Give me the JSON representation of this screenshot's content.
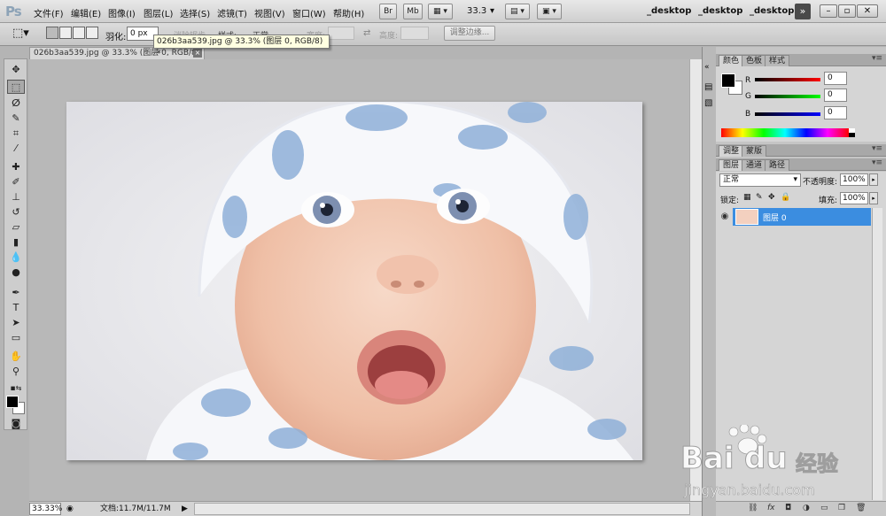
{
  "menubar": {
    "items": [
      "文件(F)",
      "编辑(E)",
      "图像(I)",
      "图层(L)",
      "选择(S)",
      "滤镜(T)",
      "视图(V)",
      "窗口(W)",
      "帮助(H)"
    ],
    "bridge_label": "Br",
    "minibridge_label": "Mb",
    "zoom_value": "33.3",
    "workspaces": [
      "_desktop",
      "_desktop",
      "_desktop"
    ],
    "more_label": "»"
  },
  "options": {
    "feather_label": "羽化:",
    "feather_value": "0 px",
    "antialias_label": "消除锯齿",
    "style_label": "样式:",
    "style_value": "正常",
    "width_label": "宽度:",
    "height_label": "高度:",
    "refine_edge_label": "调整边缘..."
  },
  "tooltip": "026b3aa539.jpg @ 33.3% (图层 0, RGB/8) *",
  "document": {
    "tab_title": "026b3aa539.jpg @ 33.3% (图层 0, RGB/8) *",
    "close_label": "×"
  },
  "statusbar": {
    "zoom": "33.33%",
    "doc_info": "文档:11.7M/11.7M"
  },
  "color_panel": {
    "tabs": [
      "颜色",
      "色板",
      "样式"
    ],
    "channels": [
      {
        "label": "R",
        "value": "0",
        "color": "#e02020"
      },
      {
        "label": "G",
        "value": "0",
        "color": "#20c020"
      },
      {
        "label": "B",
        "value": "0",
        "color": "#2040e0"
      }
    ]
  },
  "adjust_panel": {
    "tabs": [
      "调整",
      "蒙版"
    ]
  },
  "layers_panel": {
    "tabs": [
      "图层",
      "通道",
      "路径"
    ],
    "blend_mode": "正常",
    "opacity_label": "不透明度:",
    "opacity_value": "100%",
    "lock_label": "锁定:",
    "fill_label": "填充:",
    "fill_value": "100%",
    "layers": [
      {
        "name": "图层 0",
        "visible": true,
        "selected": true
      }
    ]
  },
  "watermark": {
    "brand": "Bai",
    "brand2": "du",
    "jingyan": "经验",
    "url": "jingyan.baidu.com"
  },
  "accent_color": "#3b8de0"
}
